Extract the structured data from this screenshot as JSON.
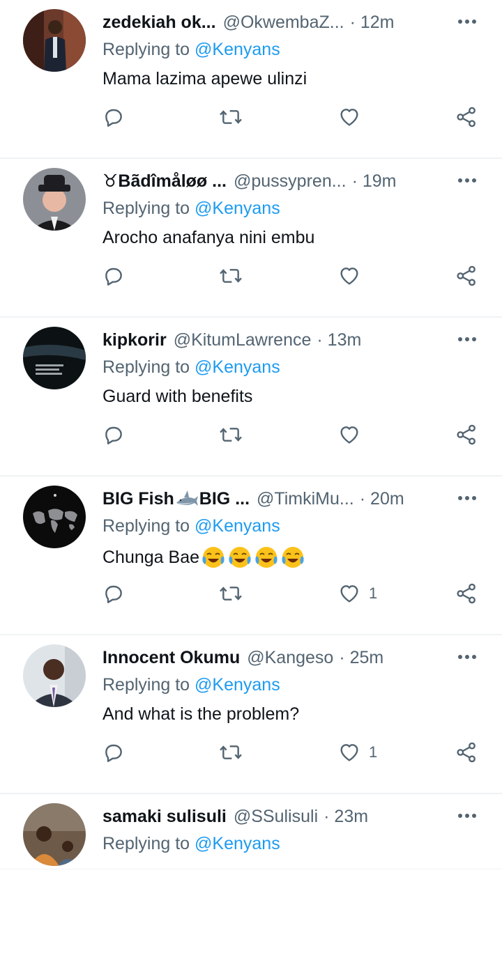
{
  "tweets": [
    {
      "name": "zedekiah ok...",
      "handle": "@OkwembaZ...",
      "time": "· 12m",
      "replying_label": "Replying to",
      "mention": "@Kenyans",
      "text": "Mama lazima apewe ulinzi",
      "likes": ""
    },
    {
      "name": "♉Bãdîmåløø ...",
      "handle": "@pussypren...",
      "time": "· 19m",
      "replying_label": "Replying to",
      "mention": "@Kenyans",
      "text": "Arocho anafanya nini embu",
      "likes": ""
    },
    {
      "name": "kipkorir",
      "handle": "@KitumLawrence",
      "time": "· 13m",
      "replying_label": "Replying to",
      "mention": "@Kenyans",
      "text": "Guard with benefits",
      "likes": ""
    },
    {
      "name": "BIG Fish",
      "name_suffix": "BIG ...",
      "handle": "@TimkiMu...",
      "time": "· 20m",
      "replying_label": "Replying to",
      "mention": "@Kenyans",
      "text": "Chunga Bae",
      "likes": "1"
    },
    {
      "name": "Innocent Okumu",
      "handle": "@Kangeso",
      "time": "· 25m",
      "replying_label": "Replying to",
      "mention": "@Kenyans",
      "text": "And what is the problem?",
      "likes": "1"
    },
    {
      "name": "samaki sulisuli",
      "handle": "@SSulisuli",
      "time": "· 23m",
      "replying_label": "Replying to",
      "mention": "@Kenyans",
      "text": "",
      "likes": ""
    }
  ],
  "colors": {
    "text": "#0f1419",
    "secondary": "#536471",
    "accent": "#1d9bf0",
    "divider": "#eff3f4"
  },
  "icons": {
    "reply": "reply-icon",
    "retweet": "retweet-icon",
    "like": "heart-icon",
    "share": "share-icon",
    "more": "more-options-icon"
  }
}
